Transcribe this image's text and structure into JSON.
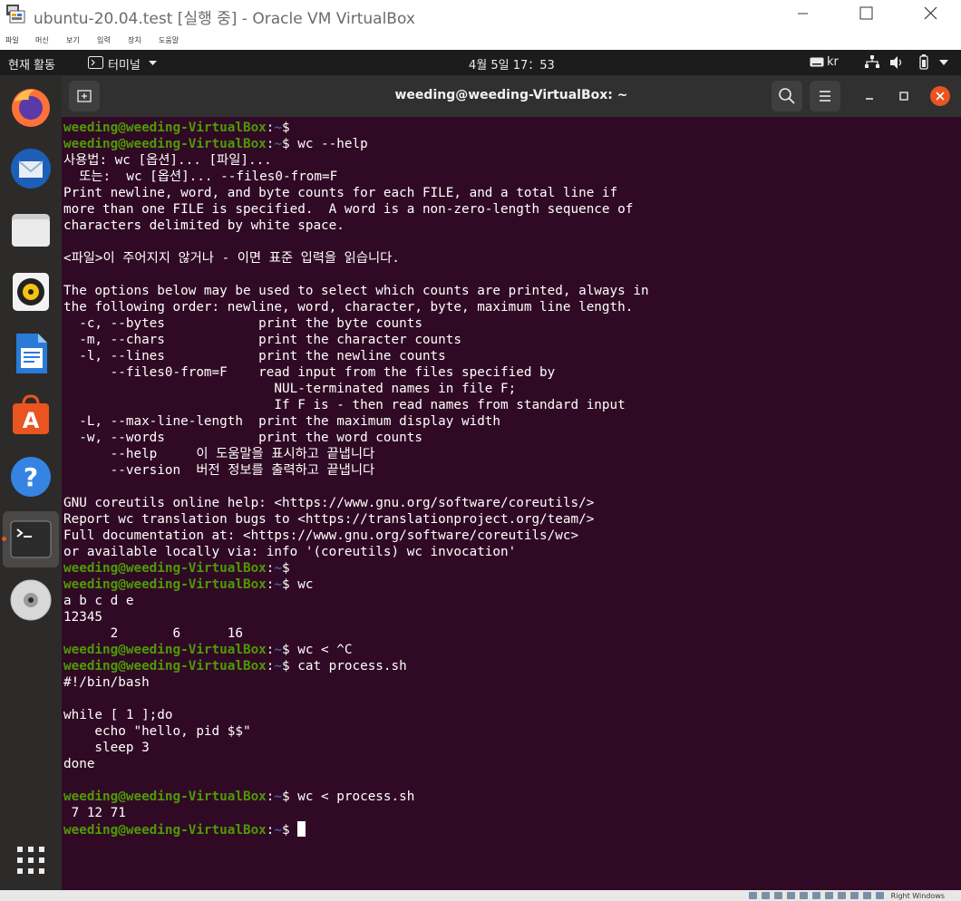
{
  "window": {
    "title": "ubuntu-20.04.test [실행 중] - Oracle VM VirtualBox",
    "menu": [
      "파일",
      "머신",
      "보기",
      "입력",
      "장치",
      "도움말"
    ]
  },
  "topbar": {
    "activities": "현재 활동",
    "app_menu": "터미널",
    "clock": "4월 5일  17：53",
    "keyboard_layout": "kr"
  },
  "dock": {
    "items": [
      "firefox-icon",
      "thunderbird-icon",
      "files-icon",
      "rhythmbox-icon",
      "libreoffice-writer-icon",
      "ubuntu-software-icon",
      "help-icon",
      "terminal-icon",
      "dvd-icon"
    ],
    "show_apps": "grid-icon"
  },
  "terminal": {
    "title": "weeding@weeding-VirtualBox: ~",
    "user": "weeding@weeding-VirtualBox",
    "path": "~",
    "lines": [
      {
        "cmd": ""
      },
      {
        "cmd": "wc --help"
      },
      {
        "text": "사용법: wc [옵션]... [파일]..."
      },
      {
        "text": "  또는:  wc [옵션]... --files0-from=F"
      },
      {
        "text": "Print newline, word, and byte counts for each FILE, and a total line if"
      },
      {
        "text": "more than one FILE is specified.  A word is a non-zero-length sequence of"
      },
      {
        "text": "characters delimited by white space."
      },
      {
        "text": ""
      },
      {
        "text": "<파일>이 주어지지 않거나 - 이면 표준 입력을 읽습니다."
      },
      {
        "text": ""
      },
      {
        "text": "The options below may be used to select which counts are printed, always in"
      },
      {
        "text": "the following order: newline, word, character, byte, maximum line length."
      },
      {
        "text": "  -c, --bytes            print the byte counts"
      },
      {
        "text": "  -m, --chars            print the character counts"
      },
      {
        "text": "  -l, --lines            print the newline counts"
      },
      {
        "text": "      --files0-from=F    read input from the files specified by"
      },
      {
        "text": "                           NUL-terminated names in file F;"
      },
      {
        "text": "                           If F is - then read names from standard input"
      },
      {
        "text": "  -L, --max-line-length  print the maximum display width"
      },
      {
        "text": "  -w, --words            print the word counts"
      },
      {
        "text": "      --help     이 도움말을 표시하고 끝냅니다"
      },
      {
        "text": "      --version  버전 정보를 출력하고 끝냅니다"
      },
      {
        "text": ""
      },
      {
        "text": "GNU coreutils online help: <https://www.gnu.org/software/coreutils/>"
      },
      {
        "text": "Report wc translation bugs to <https://translationproject.org/team/>"
      },
      {
        "text": "Full documentation at: <https://www.gnu.org/software/coreutils/wc>"
      },
      {
        "text": "or available locally via: info '(coreutils) wc invocation'"
      },
      {
        "cmd": ""
      },
      {
        "cmd": "wc"
      },
      {
        "text": "a b c d e"
      },
      {
        "text": "12345"
      },
      {
        "text": "      2       6      16"
      },
      {
        "cmd": "wc < ^C"
      },
      {
        "cmd": "cat process.sh"
      },
      {
        "text": "#!/bin/bash"
      },
      {
        "text": ""
      },
      {
        "text": "while [ 1 ];do"
      },
      {
        "text": "    echo \"hello, pid $$\""
      },
      {
        "text": "    sleep 3"
      },
      {
        "text": "done"
      },
      {
        "text": ""
      },
      {
        "cmd": "wc < process.sh"
      },
      {
        "text": " 7 12 71"
      },
      {
        "cmd": "",
        "cursor": true
      }
    ]
  },
  "host_taskbar": {
    "label": "Right Windows"
  },
  "colors": {
    "terminal_bg": "#300a24",
    "prompt_user": "#4e9a06",
    "prompt_path": "#3465a4",
    "accent": "#e95420"
  }
}
